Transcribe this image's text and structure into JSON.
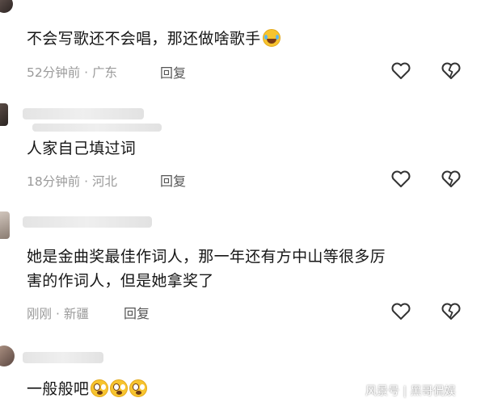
{
  "comments": [
    {
      "text": "不会写歌还不会唱，那还做啥歌手",
      "emojis": [
        "laughing-tears"
      ],
      "time": "52分钟前",
      "location": "广东",
      "reply_label": "回复"
    },
    {
      "text": "人家自己填过词",
      "emojis": [],
      "time": "18分钟前",
      "location": "河北",
      "reply_label": "回复"
    },
    {
      "text": "她是金曲奖最佳作词人，那一年还有方中山等很多厉害的作词人，但是她拿奖了",
      "emojis": [],
      "time": "刚刚",
      "location": "新疆",
      "reply_label": "回复"
    },
    {
      "text": "一般般吧",
      "emojis": [
        "shocked-face",
        "shocked-face",
        "shocked-face"
      ],
      "time": "",
      "location": "",
      "reply_label": ""
    }
  ],
  "separator": "·",
  "icons": {
    "like": "heart-outline-icon",
    "dislike": "broken-heart-icon"
  },
  "watermark": "风景号 | 黑哥侃娱"
}
